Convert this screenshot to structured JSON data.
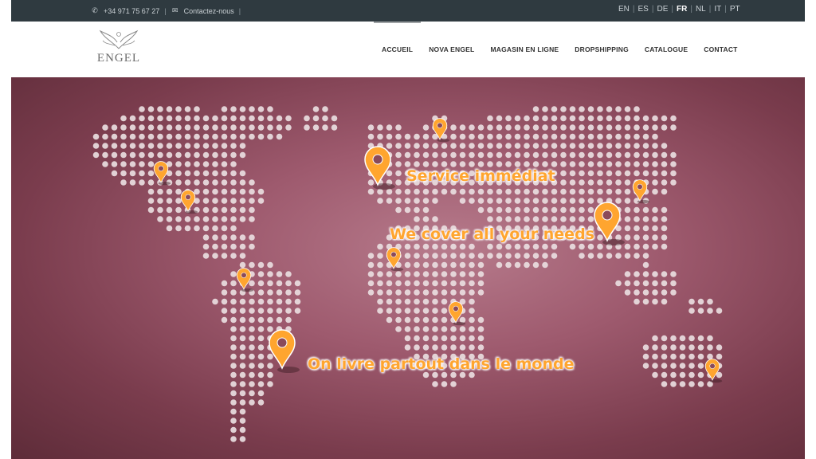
{
  "topbar": {
    "phone": "+34 971 75 67 27",
    "contact_label": "Contactez-nous",
    "phone_icon": "phone-icon",
    "mail_icon": "envelope-icon",
    "languages": [
      {
        "code": "EN",
        "active": false
      },
      {
        "code": "ES",
        "active": false
      },
      {
        "code": "DE",
        "active": false
      },
      {
        "code": "FR",
        "active": true
      },
      {
        "code": "NL",
        "active": false
      },
      {
        "code": "IT",
        "active": false
      },
      {
        "code": "PT",
        "active": false
      }
    ]
  },
  "header": {
    "logo_text": "ENGEL",
    "nav": [
      {
        "label": "ACCUEIL",
        "active": true
      },
      {
        "label": "NOVA ENGEL",
        "active": false
      },
      {
        "label": "MAGASIN EN LIGNE",
        "active": false
      },
      {
        "label": "DROPSHIPPING",
        "active": false
      },
      {
        "label": "CATALOGUE",
        "active": false
      },
      {
        "label": "CONTACT",
        "active": false
      }
    ]
  },
  "hero": {
    "tagline_1": "Service immédiat",
    "tagline_2": "We cover all your needs",
    "tagline_3": "On livre partout dans le monde",
    "accent_color": "#ffa52f",
    "background_color": "#9e5a6e"
  }
}
